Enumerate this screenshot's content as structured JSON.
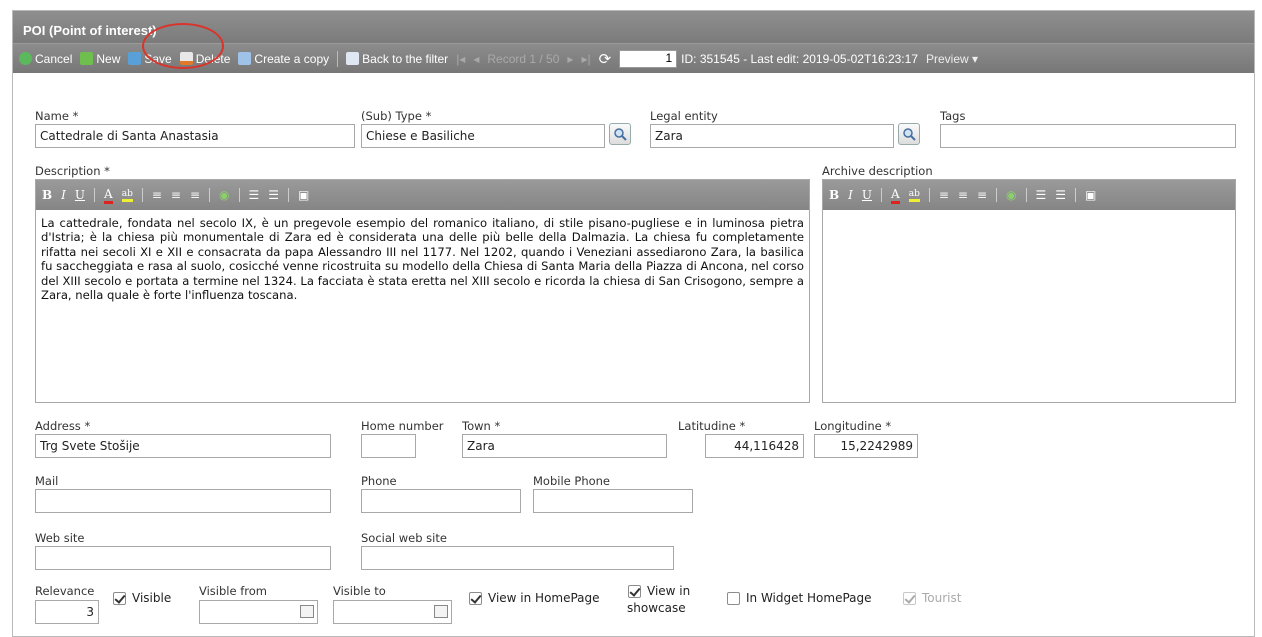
{
  "window": {
    "title": "POI (Point of interest)"
  },
  "toolbar": {
    "cancel": "Cancel",
    "new": "New",
    "save": "Save",
    "delete": "Delete",
    "copy": "Create a copy",
    "back": "Back to the filter",
    "record": "Record 1 / 50",
    "record_number": "1",
    "info": "ID: 351545 - Last edit: 2019-05-02T16:23:17",
    "preview": "Preview ▾"
  },
  "form": {
    "name": {
      "label": "Name *",
      "value": "Cattedrale di Santa Anastasia"
    },
    "subtype": {
      "label": "(Sub) Type *",
      "value": "Chiese e Basiliche"
    },
    "legal": {
      "label": "Legal entity",
      "value": "Zara"
    },
    "tags": {
      "label": "Tags",
      "value": ""
    },
    "description": {
      "label": "Description *",
      "text": "La cattedrale, fondata nel secolo IX, è un pregevole esempio del romanico italiano, di stile pisano-pugliese e in luminosa pietra d'Istria; è la chiesa più monumentale di Zara ed è considerata una delle più belle della Dalmazia. La chiesa fu completamente rifatta nei secoli XI e XII e consacrata da papa Alessandro III nel 1177. Nel 1202, quando i Veneziani assediarono Zara, la basilica fu saccheggiata e rasa al suolo, cosicché venne ricostruita su modello della Chiesa di Santa Maria della Piazza di Ancona, nel corso del XIII secolo e portata a termine nel 1324. La facciata è stata eretta nel XIII secolo e ricorda la chiesa di San Crisogono, sempre a Zara, nella quale è forte l'influenza toscana."
    },
    "archive": {
      "label": "Archive description",
      "text": ""
    },
    "address": {
      "label": "Address *",
      "value": "Trg Svete Stošije"
    },
    "home_number": {
      "label": "Home number",
      "value": ""
    },
    "town": {
      "label": "Town *",
      "value": "Zara"
    },
    "latitude": {
      "label": "Latitudine *",
      "value": "44,116428"
    },
    "longitude": {
      "label": "Longitudine *",
      "value": "15,2242989"
    },
    "mail": {
      "label": "Mail",
      "value": ""
    },
    "phone": {
      "label": "Phone",
      "value": ""
    },
    "mobile": {
      "label": "Mobile Phone",
      "value": ""
    },
    "website": {
      "label": "Web site",
      "value": ""
    },
    "social": {
      "label": "Social web site",
      "value": ""
    },
    "relevance": {
      "label": "Relevance",
      "value": "3"
    },
    "visible": {
      "label": "Visible",
      "checked": true
    },
    "visible_from": {
      "label": "Visible from",
      "value": ""
    },
    "visible_to": {
      "label": "Visible to",
      "value": ""
    },
    "homepage": {
      "label": "View in HomePage",
      "checked": true
    },
    "showcase": {
      "label_1": "View in",
      "label_2": "showcase",
      "checked": true
    },
    "widget": {
      "label": "In Widget HomePage",
      "checked": false
    },
    "tourist": {
      "label": "Tourist",
      "checked": true
    }
  },
  "editor_toolbar": {
    "bold": "B",
    "italic": "I",
    "underline": "U",
    "font_color": "A",
    "highlight": "ab"
  },
  "colors": {
    "header": "#7b7b7b",
    "annotation": "#d9342b"
  }
}
